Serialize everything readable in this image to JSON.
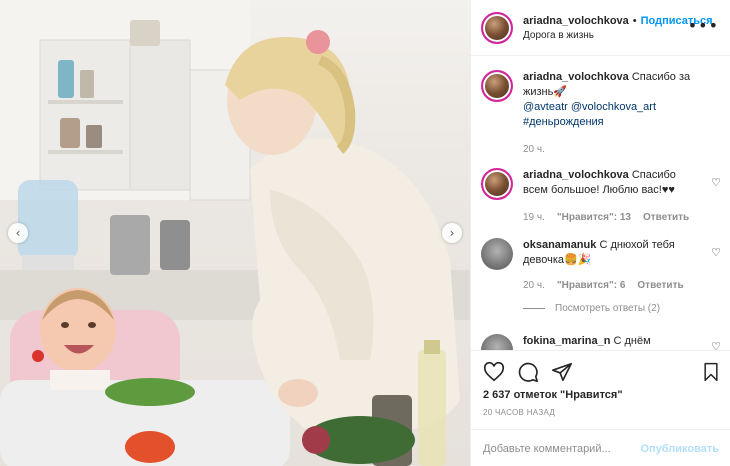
{
  "post": {
    "username": "ariadna_volochkova",
    "follow_label": "Подписаться",
    "separator": "•",
    "location": "Дорога в жизнь",
    "more_label": "•••"
  },
  "caption": {
    "username": "ariadna_volochkova",
    "text": "Спасибо за жизнь🚀",
    "mention_1": "@avteatr",
    "mention_2": "@volochkova_art",
    "hashtag": "#деньрождения",
    "time": "20 ч."
  },
  "comments": [
    {
      "username": "ariadna_volochkova",
      "text": "Спасибо всем большое! Люблю вас!♥♥",
      "time": "19 ч.",
      "likes": "\"Нравится\": 13",
      "reply": "Ответить"
    },
    {
      "username": "oksanamanuk",
      "text": "С днюхой тебя девочка🍔🎉",
      "time": "20 ч.",
      "likes": "\"Нравится\": 6",
      "reply": "Ответить",
      "view_replies": "Посмотреть ответы (2)"
    },
    {
      "username": "fokina_marina_n",
      "text": "С днём"
    }
  ],
  "likes_text": "2 637 отметок \"Нравится\"",
  "timestamp": "20 ЧАСОВ НАЗАД",
  "comment_input": {
    "placeholder": "Добавьте комментарий...",
    "value": ""
  },
  "publish_label": "Опубликовать",
  "icons": {
    "like": "heart-icon",
    "comment": "comment-icon",
    "share": "paper-plane-icon",
    "save": "bookmark-icon",
    "prev": "chevron-left-icon",
    "next": "chevron-right-icon"
  },
  "colors": {
    "accent": "#0095f6",
    "text": "#262626",
    "muted": "#8e8e8e",
    "publish_disabled": "#b2dffc"
  }
}
